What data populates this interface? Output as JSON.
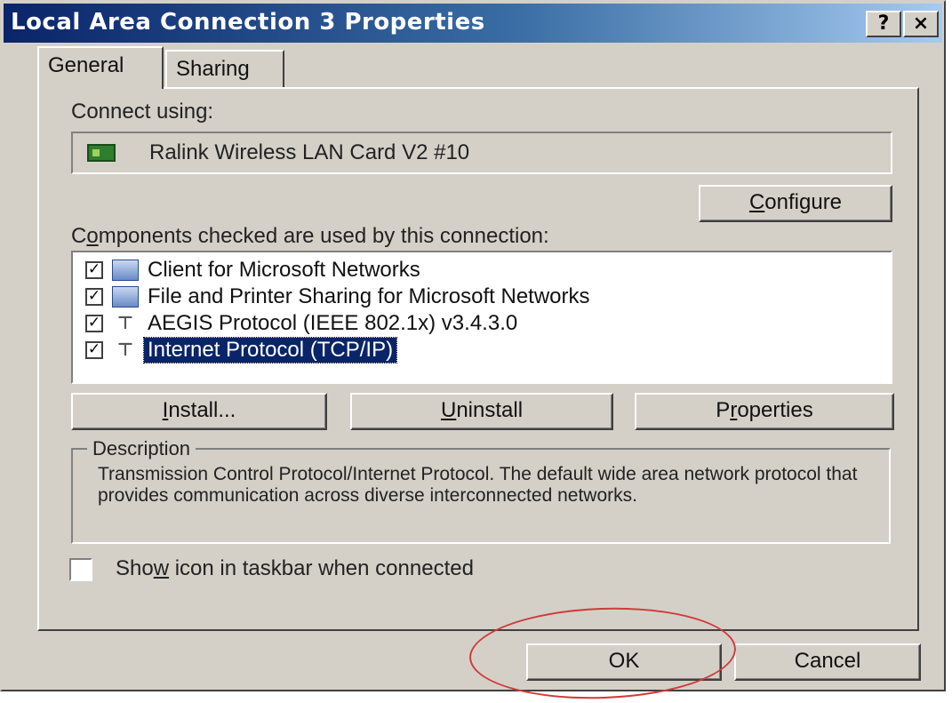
{
  "window": {
    "title": "Local Area Connection 3 Properties",
    "help_label": "?",
    "close_label": "×"
  },
  "tabs": [
    {
      "label": "General",
      "selected": true
    },
    {
      "label": "Sharing",
      "selected": false
    }
  ],
  "general": {
    "connect_using_label": "Connect using:",
    "adapter_name": "Ralink Wireless LAN Card V2 #10",
    "configure_pre": "",
    "configure_accel": "C",
    "configure_post": "onfigure",
    "components_pre": "C",
    "components_accel": "o",
    "components_post": "mponents checked are used by this connection:",
    "components": [
      {
        "label": "Client for Microsoft Networks",
        "checked": true,
        "icon": "network-client-icon",
        "selected": false
      },
      {
        "label": "File and Printer Sharing for Microsoft Networks",
        "checked": true,
        "icon": "file-printer-sharing-icon",
        "selected": false
      },
      {
        "label": "AEGIS Protocol (IEEE 802.1x) v3.4.3.0",
        "checked": true,
        "icon": "protocol-icon",
        "selected": false
      },
      {
        "label": "Internet Protocol (TCP/IP)",
        "checked": true,
        "icon": "protocol-icon",
        "selected": true
      }
    ],
    "install_accel": "I",
    "install_post": "nstall...",
    "uninstall_accel": "U",
    "uninstall_post": "ninstall",
    "properties_pre": "P",
    "properties_accel": "r",
    "properties_post": "operties",
    "description_title": "Description",
    "description_text": "Transmission Control Protocol/Internet Protocol. The default wide area network protocol that provides communication across diverse interconnected networks.",
    "show_icon_pre": "Sho",
    "show_icon_accel": "w",
    "show_icon_post": " icon in taskbar when connected",
    "show_icon_checked": false
  },
  "footer": {
    "ok_label": "OK",
    "cancel_label": "Cancel"
  },
  "colors": {
    "dialog_face": "#d4d0c8",
    "title_bar": "#0a246a",
    "selection": "#0a246a",
    "annotation": "#d03a3a"
  }
}
